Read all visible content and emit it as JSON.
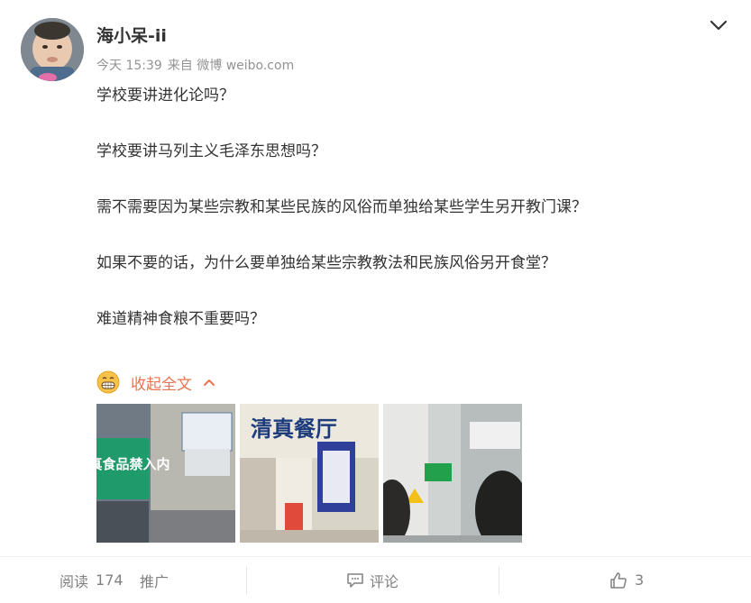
{
  "post": {
    "username": "海小呆-ii",
    "time": "今天 15:39",
    "source": "来自 微博 weibo.com",
    "paragraphs": [
      "学校要讲进化论吗？",
      "学校要讲马列主义毛泽东思想吗？",
      "需不需要因为某些宗教和某些民族的风俗而单独给某些学生另开教门课？",
      "如果不要的话，为什么要单独给某些宗教教法和民族风俗另开食堂？",
      "难道精神食粮不重要吗？"
    ],
    "collapse_label": "收起全文",
    "photos": [
      {
        "sign_text": "清真食品禁入内",
        "icon": "photo-sign-no-halal-food"
      },
      {
        "sign_text": "清真餐厅",
        "icon": "photo-halal-canteen"
      },
      {
        "sign_text": "",
        "icon": "photo-corridor"
      }
    ]
  },
  "footer": {
    "read_label": "阅读",
    "read_count": "174",
    "promote_label": "推广",
    "comment_label": "评论",
    "like_count": "3"
  },
  "colors": {
    "accent": "#eb7350",
    "text": "#333333",
    "meta": "#939393"
  },
  "icons": {
    "menu": "chevron-down-icon",
    "collapse": "chevron-up-icon",
    "comment": "comment-icon",
    "like": "thumbs-up-icon"
  }
}
